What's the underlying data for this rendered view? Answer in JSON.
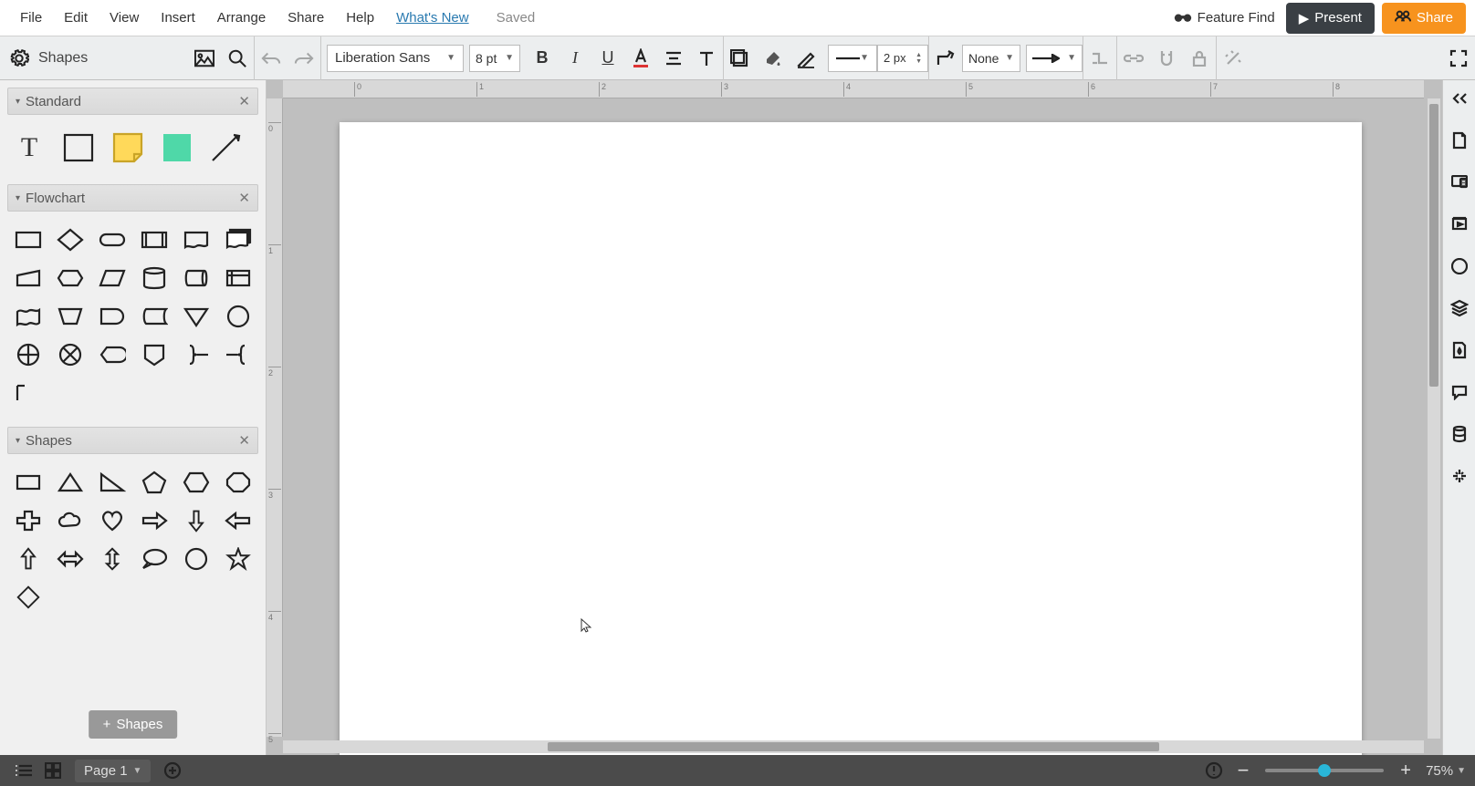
{
  "menu": {
    "file": "File",
    "edit": "Edit",
    "view": "View",
    "insert": "Insert",
    "arrange": "Arrange",
    "share": "Share",
    "help": "Help",
    "whatsnew": "What's New",
    "saved": "Saved"
  },
  "topright": {
    "feature_find": "Feature Find",
    "present": "Present",
    "share": "Share"
  },
  "toolbar": {
    "shapes_title": "Shapes",
    "font_family": "Liberation Sans",
    "font_size": "8 pt",
    "line_width": "2 px",
    "line_end_style": "None"
  },
  "panels": {
    "standard": "Standard",
    "flowchart": "Flowchart",
    "shapes": "Shapes",
    "add_shapes": "Shapes"
  },
  "bottom": {
    "page": "Page 1",
    "zoom": "75%"
  },
  "ruler_h": [
    "0",
    "1",
    "2",
    "3",
    "4",
    "5",
    "6",
    "7",
    "8"
  ],
  "ruler_v": [
    "0",
    "1",
    "2",
    "3",
    "4",
    "5"
  ]
}
